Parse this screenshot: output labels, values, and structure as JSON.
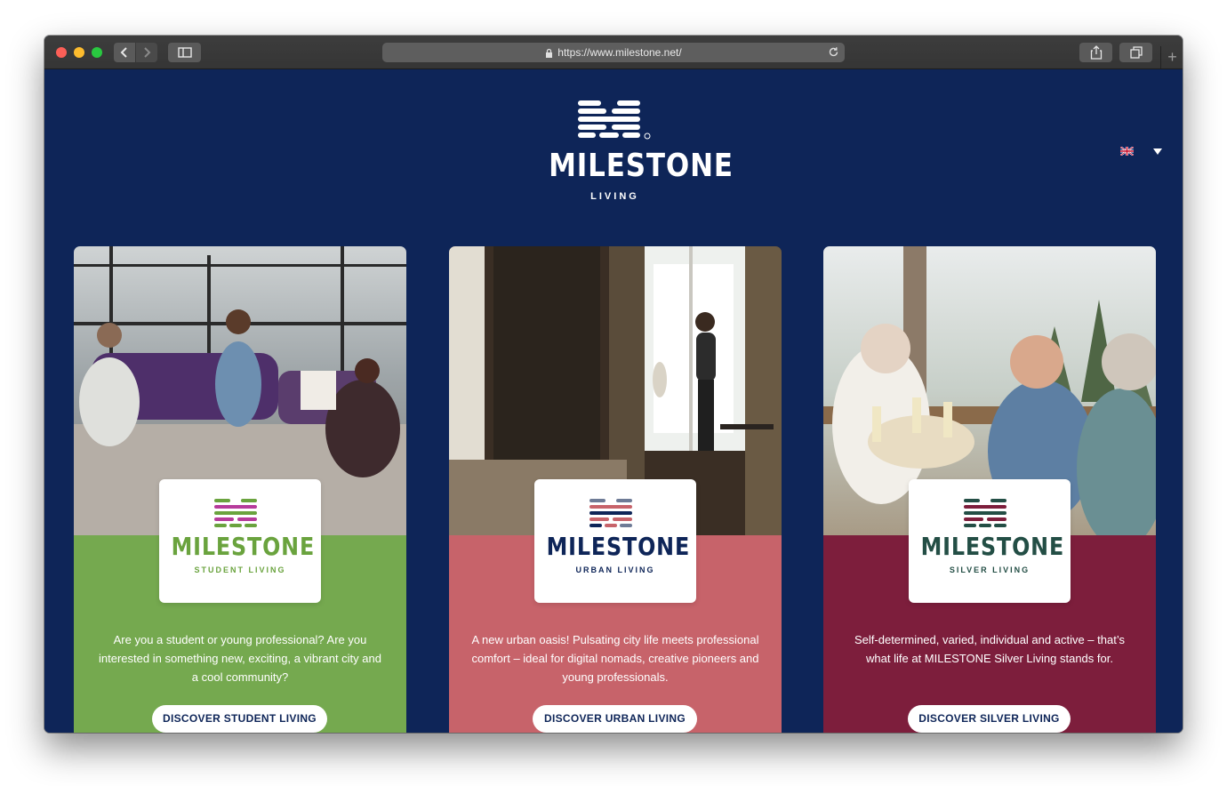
{
  "browser": {
    "url": "https://www.milestone.net/",
    "icons": {
      "back": "chevron-left-icon",
      "forward": "chevron-right-icon",
      "sidebar": "sidebar-icon",
      "lock": "lock-icon",
      "reload": "reload-icon",
      "share": "share-icon",
      "tabs": "tabs-icon",
      "new_tab": "plus-icon"
    },
    "new_tab_label": "+"
  },
  "header": {
    "brand": "MILESTONE",
    "subtitle": "LIVING",
    "language": "en-GB",
    "language_icon": "uk-flag-icon"
  },
  "colors": {
    "page_bg": "#0e2558",
    "student": "#75a94f",
    "urban": "#c7636a",
    "silver": "#7d1e3c",
    "student_text": "#6aa33e",
    "urban_text": "#0e2558",
    "silver_text": "#234e45"
  },
  "cards": [
    {
      "brand": "MILESTONE",
      "subtitle": "STUDENT LIVING",
      "description": "Are you a student or young professional? Are you interested in something new, exciting, a vibrant city and a cool community?",
      "button": "DISCOVER STUDENT LIVING"
    },
    {
      "brand": "MILESTONE",
      "subtitle": "URBAN LIVING",
      "description": "A new urban oasis! Pulsating city life meets professional comfort – ideal for digital nomads, creative pioneers and young professionals.",
      "button": "DISCOVER URBAN LIVING"
    },
    {
      "brand": "MILESTONE",
      "subtitle": "SILVER LIVING",
      "description": "Self-determined, varied, individual and active – that’s what life at MILESTONE Silver Living stands for.",
      "button": "DISCOVER SILVER LIVING"
    }
  ]
}
